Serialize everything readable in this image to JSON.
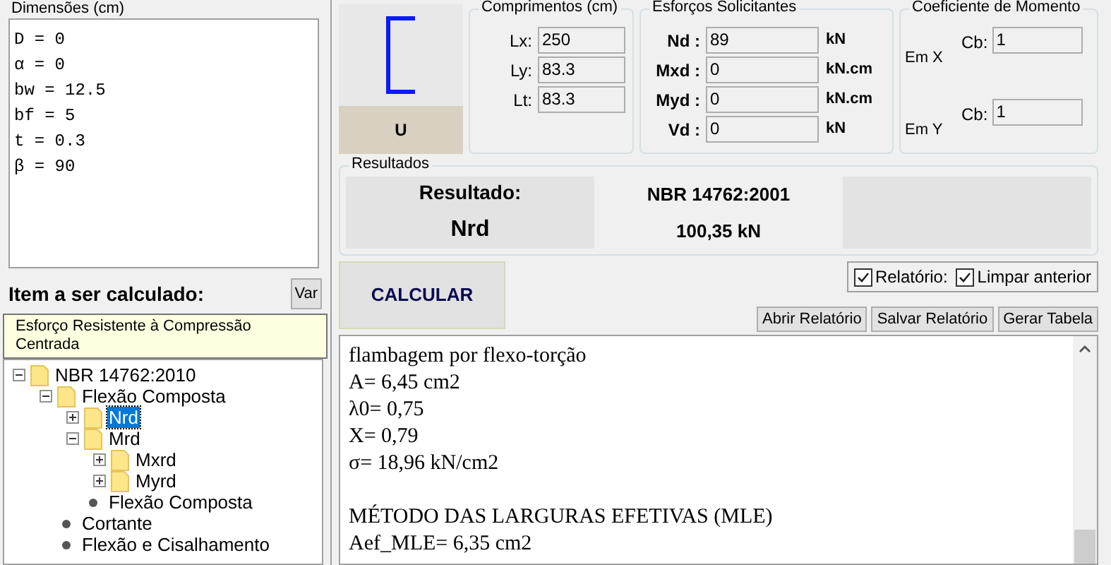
{
  "dimensions": {
    "title": "Dimensões (cm)",
    "lines": [
      "D = 0",
      "α = 0",
      "bw = 12.5",
      "bf = 5",
      "t = 0.3",
      "β = 90"
    ]
  },
  "item_panel": {
    "title": "Item a ser calculado:",
    "var_button": "Var",
    "tooltip": "Esforço Resistente à Compressão Centrada"
  },
  "tree": [
    {
      "label": "NBR 14762:2010",
      "kind": "folder",
      "expanded": true,
      "selected": false,
      "children": [
        {
          "label": "Flexão Composta",
          "kind": "folder",
          "expanded": true,
          "selected": false,
          "children": [
            {
              "label": "Nrd",
              "kind": "folder",
              "expanded": false,
              "selected": true
            },
            {
              "label": "Mrd",
              "kind": "folder",
              "expanded": true,
              "selected": false,
              "children": [
                {
                  "label": "Mxrd",
                  "kind": "folder",
                  "expanded": false,
                  "selected": false
                },
                {
                  "label": "Myrd",
                  "kind": "folder",
                  "expanded": false,
                  "selected": false
                }
              ]
            },
            {
              "label": "Flexão Composta",
              "kind": "leaf",
              "selected": false
            }
          ]
        },
        {
          "label": "Cortante",
          "kind": "leaf",
          "selected": false
        },
        {
          "label": "Flexão e Cisalhamento",
          "kind": "leaf",
          "selected": false
        }
      ]
    }
  ],
  "section": {
    "label": "U"
  },
  "lengths": {
    "title": "Comprimentos (cm)",
    "fields": [
      {
        "label": "Lx:",
        "value": "250"
      },
      {
        "label": "Ly:",
        "value": "83.3"
      },
      {
        "label": "Lt:",
        "value": "83.3"
      }
    ]
  },
  "forces": {
    "title": "Esforços Solicitantes",
    "fields": [
      {
        "label": "Nd :",
        "value": "89",
        "unit": "kN"
      },
      {
        "label": "Mxd :",
        "value": "0",
        "unit": "kN.cm"
      },
      {
        "label": "Myd :",
        "value": "0",
        "unit": "kN.cm"
      },
      {
        "label": "Vd :",
        "value": "0",
        "unit": "kN"
      }
    ]
  },
  "moment": {
    "title": "Coeficiente de Momento",
    "rows": [
      {
        "axis": "Em X",
        "label": "Cb:",
        "value": "1"
      },
      {
        "axis": "Em Y",
        "label": "Cb:",
        "value": "1"
      }
    ]
  },
  "results": {
    "title": "Resultados",
    "heading": "Resultado:",
    "name": "Nrd",
    "norm": "NBR 14762:2001",
    "value": "100,35 kN"
  },
  "options": [
    {
      "label": "Relatório:",
      "checked": true
    },
    {
      "label": "Limpar anterior",
      "checked": true
    }
  ],
  "calculate_button": "CALCULAR",
  "report_buttons": [
    "Abrir Relatório",
    "Salvar Relatório",
    "Gerar Tabela"
  ],
  "report_paragraphs": [
    [
      "flambagem por flexo-torção",
      "A= 6,45 cm2",
      "λ0= 0,75",
      "X= 0,79",
      "σ= 18,96 kN/cm2"
    ],
    [
      "MÉTODO DAS LARGURAS EFETIVAS (MLE)",
      "Aef_MLE= 6,35 cm2"
    ]
  ]
}
